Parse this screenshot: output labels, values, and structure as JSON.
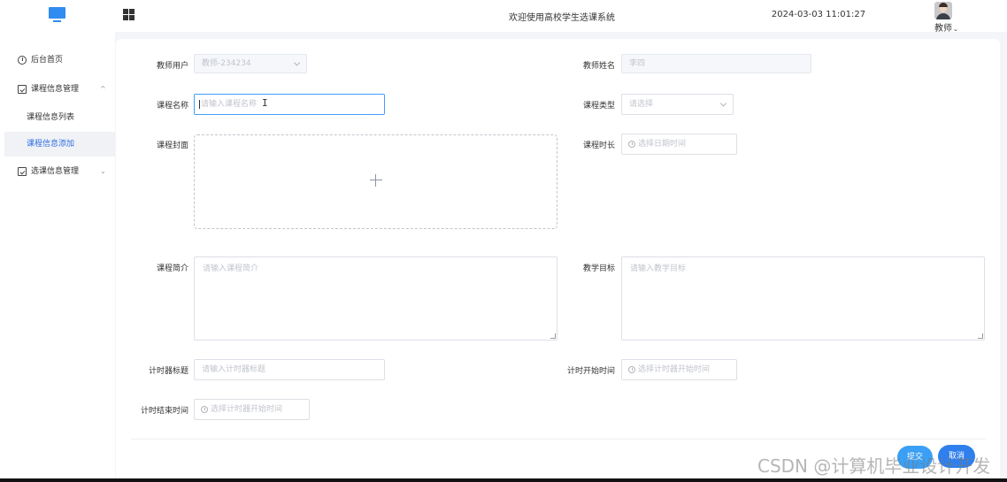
{
  "header": {
    "system_title": "欢迎使用高校学生选课系统",
    "datetime": "2024-03-03 11:01:27",
    "role": "教师",
    "role_caret": "⌄"
  },
  "sidebar": {
    "items": [
      {
        "label": "后台首页",
        "icon": "clock-icon"
      },
      {
        "label": "课程信息管理",
        "icon": "box-icon",
        "arrow": "^"
      },
      {
        "label": "课程信息列表"
      },
      {
        "label": "课程信息添加",
        "active": true
      },
      {
        "label": "选课信息管理",
        "icon": "box-icon",
        "arrow": "⌄"
      }
    ]
  },
  "form": {
    "teacher_account": {
      "label": "教师用户",
      "value": "教师-234234"
    },
    "teacher_name": {
      "label": "教师姓名",
      "value": "李四"
    },
    "course_name": {
      "label": "课程名称",
      "placeholder": "请输入课程名称"
    },
    "course_type": {
      "label": "课程类型",
      "placeholder": "请选择"
    },
    "course_cover": {
      "label": "课程封面"
    },
    "course_duration": {
      "label": "课程时长",
      "placeholder": "选择日期时间"
    },
    "course_intro": {
      "label": "课程简介",
      "placeholder": "请输入课程简介"
    },
    "teaching_goal": {
      "label": "教学目标",
      "placeholder": "请输入教学目标"
    },
    "timer_title": {
      "label": "计时器标题",
      "placeholder": "请输入计时器标题"
    },
    "timer_start": {
      "label": "计时开始时间",
      "placeholder": "选择计时器开始时间"
    },
    "timer_end": {
      "label": "计时结束时间",
      "placeholder": "选择计时器开始时间"
    }
  },
  "actions": {
    "submit_label": "提交",
    "cancel_label": "取消"
  },
  "watermark": "CSDN @计算机毕业设计开发",
  "colors": {
    "accent": "#2f8cf0",
    "active_menu_text": "#2f6fe0",
    "submit_button": "#3a9ff5",
    "cancel_button": "#2f80ed"
  }
}
